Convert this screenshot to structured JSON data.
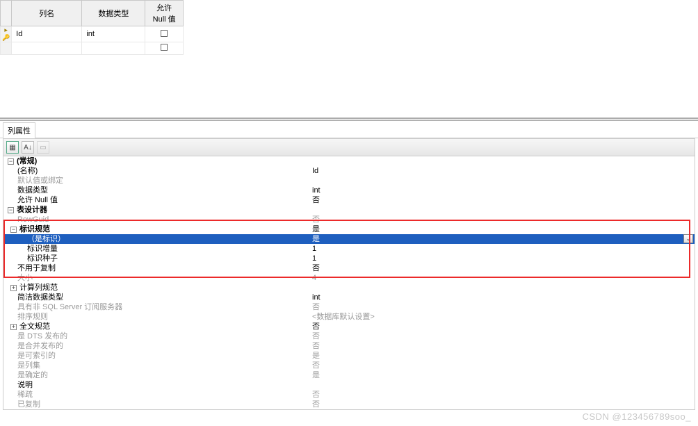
{
  "grid": {
    "headers": {
      "colname": "列名",
      "datatype": "数据类型",
      "allownull": "允许 Null 值"
    },
    "rows": [
      {
        "name": "Id",
        "type": "int",
        "nullable": false,
        "is_key": true,
        "selected": true
      }
    ]
  },
  "panel": {
    "title": "列属性"
  },
  "toolbar": {
    "btn_cat": "categorized",
    "btn_az": "alphabetical",
    "btn_page": "property-page"
  },
  "props": {
    "general_header": "(常规)",
    "name_label": "(名称)",
    "name_val": "Id",
    "default_label": "默认值或绑定",
    "datatype_label": "数据类型",
    "datatype_val": "int",
    "allownull_label": "允许 Null 值",
    "allownull_val": "否",
    "designer_header": "表设计器",
    "rowguid_label": "RowGuid",
    "rowguid_val": "否",
    "identity_header": "标识规范",
    "identity_val": "是",
    "isidentity_label": "（是标识）",
    "isidentity_val": "是",
    "increment_label": "标识增量",
    "increment_val": "1",
    "seed_label": "标识种子",
    "seed_val": "1",
    "notforrepl_label": "不用于复制",
    "notforrepl_val": "否",
    "size_label": "大小",
    "size_val": "4",
    "computed_header": "计算列规范",
    "concise_label": "简洁数据类型",
    "concise_val": "int",
    "sqlsub_label": "具有非 SQL Server 订阅服务器",
    "sqlsub_val": "否",
    "collation_label": "排序规则",
    "collation_val": "<数据库默认设置>",
    "fulltext_header": "全文规范",
    "fulltext_val": "否",
    "dts_label": "是 DTS 发布的",
    "dts_val": "否",
    "merge_label": "是合并发布的",
    "merge_val": "否",
    "indexable_label": "是可索引的",
    "indexable_val": "是",
    "colset_label": "是列集",
    "colset_val": "否",
    "deterministic_label": "是确定的",
    "deterministic_val": "是",
    "desc_label": "说明",
    "sparse_label": "稀疏",
    "sparse_val": "否",
    "replicated_label": "已复制",
    "replicated_val": "否"
  },
  "watermark": "CSDN @123456789soo_"
}
